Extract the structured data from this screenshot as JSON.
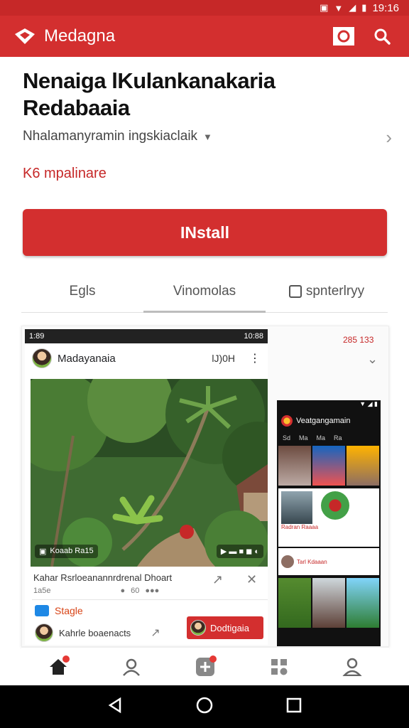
{
  "status_bar": {
    "time": "19:16"
  },
  "app_bar": {
    "title": "Medagna"
  },
  "app": {
    "name": "Nenaiga lKulankanakaria Redabaaia",
    "subtitle": "Nhalamanyramin ingskiaclaik",
    "contains": "K6 mpalinare",
    "install_label": "INstall"
  },
  "tabs": [
    {
      "label": "Egls"
    },
    {
      "label": "Vinomolas"
    },
    {
      "label": "spnterlryy"
    }
  ],
  "screenshot1": {
    "status_time": "1:89",
    "status_right": "10:88",
    "account_name": "Madayanaia",
    "tag": "lJ)0H",
    "photo_label": "Koaab Ra15",
    "caption": "Kahar Rsrloeanannrdrenal Dhoart",
    "meta": "1a5e",
    "meta2": "60",
    "section_label": "Stagle",
    "author": "Kahrle boaenacts",
    "button_label": "Dodtigaia"
  },
  "card": {
    "date": "285 133"
  },
  "screenshot2": {
    "title": "Veatgangamain",
    "tabs": [
      "Sd",
      "Ma",
      "Ma",
      "Ra"
    ],
    "caption": "Radran Raaaa",
    "caption2": "Tarl Kdaaan"
  },
  "colors": {
    "brand": "#d32f2f",
    "accent_text": "#c62828"
  }
}
